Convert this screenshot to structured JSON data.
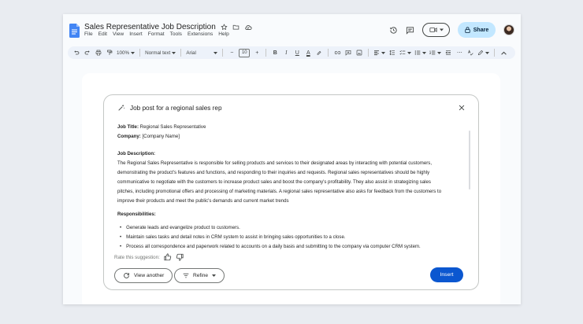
{
  "header": {
    "title": "Sales Representative Job Description",
    "menu": [
      "File",
      "Edit",
      "View",
      "Insert",
      "Format",
      "Tools",
      "Extensions",
      "Help"
    ],
    "share_label": "Share",
    "icons": [
      "star-icon",
      "folder-move-icon",
      "cloud-saved-icon",
      "history-icon",
      "comment-icon",
      "meet-video-icon",
      "lock-icon"
    ]
  },
  "toolbar": {
    "zoom": "100%",
    "style": "Normal text",
    "font": "Arial",
    "font_size": "10",
    "decrease": "−",
    "increase": "+"
  },
  "dialog": {
    "prompt": "Job post for a regional sales rep",
    "job_title_label": "Job Title:",
    "job_title_value": " Regional Sales Representative",
    "company_label": "Company:",
    "company_value": " [Company Name]",
    "description_heading": "Job Description:",
    "description_lines": [
      "The Regional Sales Representative is responsible for selling products and services to their designated areas by interacting with potential customers,",
      "demonstrating the product's features and functions, and responding to their inquiries and requests. Regional sales representatives should be highly",
      "communicative to negotiate with the customers to increase product sales and boost the company's profitability. They also assist in strategizing sales",
      "pitches, including promotional offers and processing of marketing materials. A regional sales representative also asks for feedback from the customers to",
      "improve their products and meet the public's demands and current market trends"
    ],
    "responsibilities_heading": "Responsibilities:",
    "responsibilities": [
      "Generate leads and evangelize product to customers.",
      "Maintain sales tasks and detail notes in CRM system to assist in bringing sales opportunities to a close.",
      "Process all correspondence and paperwork related to accounts on a daily basis and submitting to the company via computer CRM system."
    ],
    "rate_label": "Rate this suggestion:",
    "view_another_label": "View another",
    "refine_label": "Refine",
    "insert_label": "Insert"
  },
  "colors": {
    "accent": "#0b57d0",
    "share_bg": "#c2e7ff",
    "toolbar_bg": "#edf2fa",
    "docs_blue": "#4285f4"
  }
}
